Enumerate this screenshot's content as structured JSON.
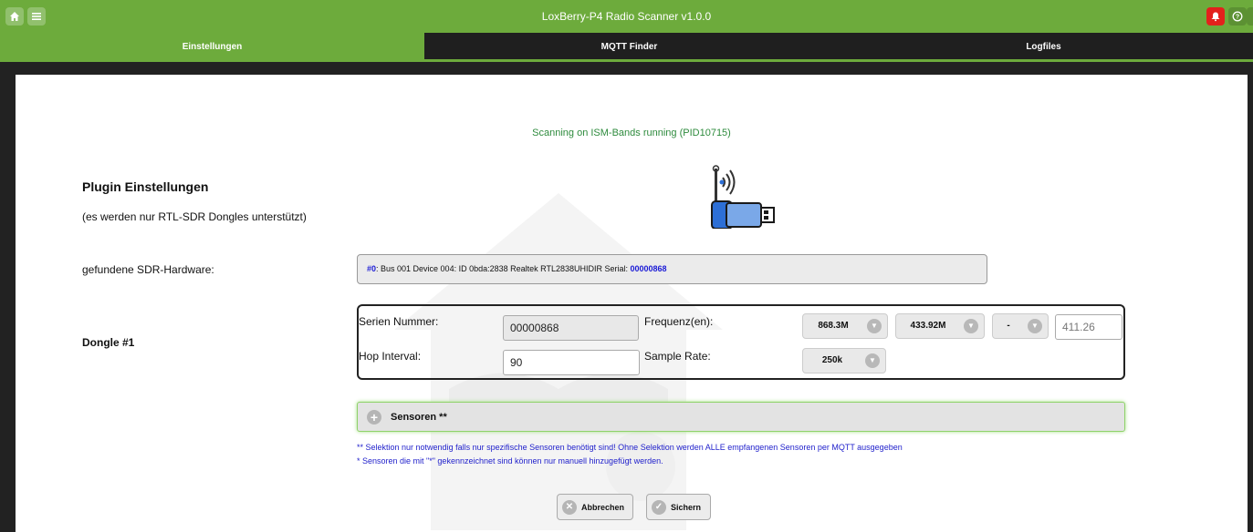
{
  "app": {
    "title": "LoxBerry-P4 Radio Scanner v1.0.0",
    "accent": "#6dab3c"
  },
  "topbar": {
    "home_icon": "home-icon",
    "menu_icon": "menu-icon",
    "bell_icon": "bell-icon",
    "help_icon": "help-icon",
    "power_icon": "power-icon"
  },
  "tabs": [
    {
      "label": "Einstellungen",
      "active": true
    },
    {
      "label": "MQTT Finder",
      "active": false
    },
    {
      "label": "Logfiles",
      "active": false
    }
  ],
  "status": "Scanning on ISM-Bands running (PID10715)",
  "plugin": {
    "title": "Plugin Einstellungen",
    "subtitle": "(es werden nur RTL-SDR Dongles unterstützt)"
  },
  "hardware": {
    "label": "gefundene SDR-Hardware:",
    "index": "#0",
    "text": ": Bus 001 Device 004: ID 0bda:2838 Realtek RTL2838UHIDIR Serial: ",
    "serial": "00000868"
  },
  "dongle": {
    "label": "Dongle #1",
    "serial_label": "Serien Nummer:",
    "serial_value": "00000868",
    "hop_label": "Hop Interval:",
    "hop_value": "90",
    "freq_label": "Frequenz(en):",
    "freq1": "868.3M",
    "freq2": "433.92M",
    "freq3": "-",
    "freq_custom": "411.26",
    "rate_label": "Sample Rate:",
    "rate_value": "250k"
  },
  "sensoren": {
    "label": "Sensoren **"
  },
  "notes": {
    "note1": "** Selektion nur notwendig falls nur spezifische Sensoren benötigt sind! Ohne Selektion werden ALLE empfangenen Sensoren per MQTT ausgegeben",
    "note2": "* Sensoren die mit \"*\" gekennzeichnet sind können nur manuell hinzugefügt werden."
  },
  "buttons": {
    "cancel": "Abbrechen",
    "save": "Sichern"
  }
}
